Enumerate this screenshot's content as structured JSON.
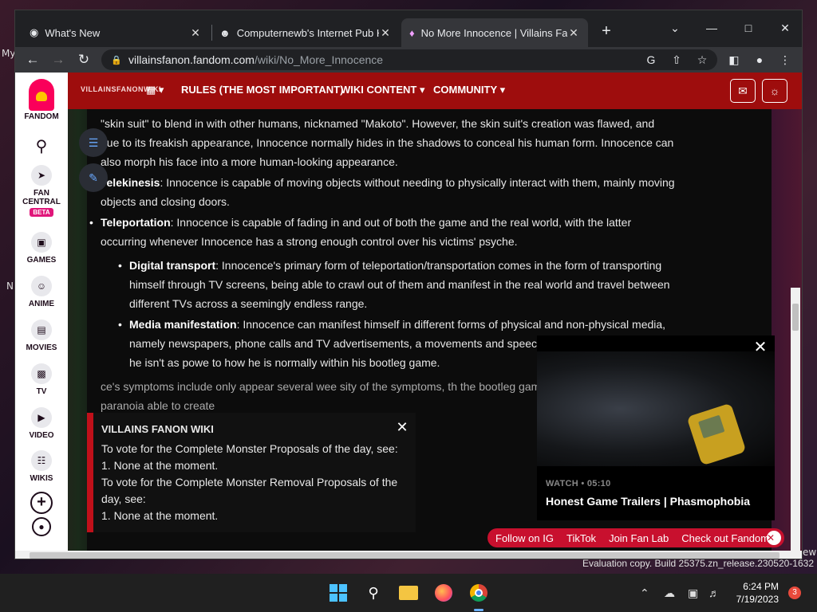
{
  "browser": {
    "tabs": [
      {
        "title": "What's New",
        "icon": "chrome-icon",
        "active": false
      },
      {
        "title": "Computernewb's Internet Pub H",
        "icon": "pub-icon",
        "active": false
      },
      {
        "title": "No More Innocence | Villains Fan",
        "icon": "fandom-icon",
        "active": true
      }
    ],
    "url_host": "villainsfanon.fandom.com",
    "url_path": "/wiki/No_More_Innocence"
  },
  "fandom": {
    "logo_label": "FANDOM",
    "rail": [
      {
        "label": "FAN\nCENTRAL",
        "badge": "BETA"
      },
      {
        "label": "GAMES"
      },
      {
        "label": "ANIME"
      },
      {
        "label": "MOVIES"
      },
      {
        "label": "TV"
      },
      {
        "label": "VIDEO"
      },
      {
        "label": "WIKIS"
      }
    ],
    "wiki_logo": "VILLAINSFANONWIKI",
    "nav": [
      "RULES (THE MOST IMPORTANT)",
      "WIKI CONTENT",
      "COMMUNITY"
    ]
  },
  "article": {
    "intro": "\"skin suit\" to blend in with other humans, nicknamed \"Makoto\". However, the skin suit's creation was flawed, and due to its freakish appearance, Innocence normally hides in the shadows to conceal his human form. Innocence can also morph his face into a more human-looking appearance.",
    "bullets": [
      {
        "term": "Telekinesis",
        "text": ": Innocence is capable of moving objects without needing to physically interact with them, mainly moving objects and closing doors."
      },
      {
        "term": "Teleportation",
        "text": ": Innocence is capable of fading in and out of both the game and the real world, with the latter occurring whenever Innocence has a strong enough control over his victims' psyche."
      }
    ],
    "subbullets": [
      {
        "term": "Digital transport",
        "text": ": Innocence's primary form of teleportation/transportation comes in the form of transporting himself through TV screens, being able to crawl out of them and manifest in the real world and travel between different TVs across a seemingly endless range."
      },
      {
        "term": "Media manifestation",
        "text": ": Innocence can manifest himself in different forms of physical and non-physical media, namely newspapers, phone calls and TV advertisements, a movements and speech patterns, likely because he isn't as powe to how he is normally within his bootleg game."
      }
    ],
    "trailing": "ce's symptoms include only appear several wee sity of the symptoms, th the bootleg game. Polic ep and severe paranoia able to create"
  },
  "notice": {
    "title": "VILLAINS FANON WIKI",
    "lines": [
      "To vote for the Complete Monster Proposals of the day, see:",
      "1. None at the moment.",
      "To vote for the Complete Monster Removal Proposals of the day, see:",
      "1. None at the moment."
    ]
  },
  "video": {
    "meta": "WATCH • 05:10",
    "title": "Honest Game Trailers | Phasmophobia"
  },
  "social": [
    "Follow on IG",
    "TikTok",
    "Join Fan Lab",
    "Check out Fandom"
  ],
  "desktop": {
    "frag_left_1": "My",
    "frag_left_2": "N",
    "frag_right": "ew",
    "watermark": "Evaluation copy. Build 25375.zn_release.230520-1632"
  },
  "taskbar": {
    "time": "6:24 PM",
    "date": "7/19/2023",
    "notifications": "3"
  },
  "colors": {
    "fandom_red": "#9e0d0d",
    "accent_pink": "#e0167a",
    "social_red": "#c8102e"
  }
}
